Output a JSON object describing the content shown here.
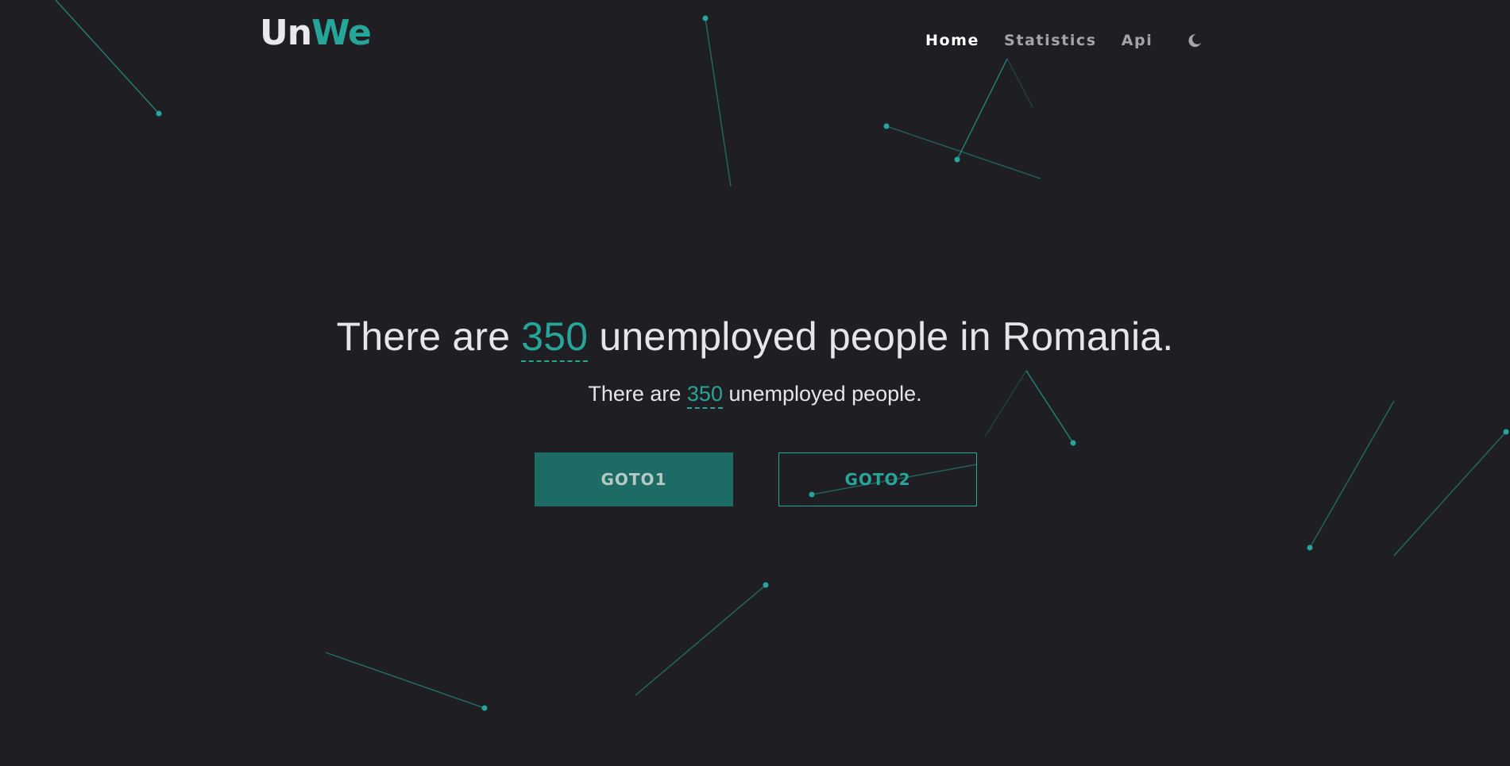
{
  "brand": {
    "logo_part1": "Un",
    "logo_part2": "We",
    "accent_color": "#26a69a"
  },
  "nav": {
    "items": [
      {
        "label": "Home",
        "active": true
      },
      {
        "label": "Statistics",
        "active": false
      },
      {
        "label": "Api",
        "active": false
      }
    ],
    "theme_toggle_icon": "moon-icon"
  },
  "hero": {
    "title_prefix": "There are",
    "title_number": "350",
    "title_suffix": "unemployed people in Romania.",
    "subtitle_prefix": "There are",
    "subtitle_number": "350",
    "subtitle_suffix": "unemployed people."
  },
  "buttons": {
    "primary_label": "GOTO1",
    "secondary_label": "GOTO2"
  },
  "colors": {
    "background": "#1f1f23",
    "text": "#e6e6ea",
    "nav_inactive": "#a4a4ad",
    "primary_button_bg": "#1c6b64"
  }
}
